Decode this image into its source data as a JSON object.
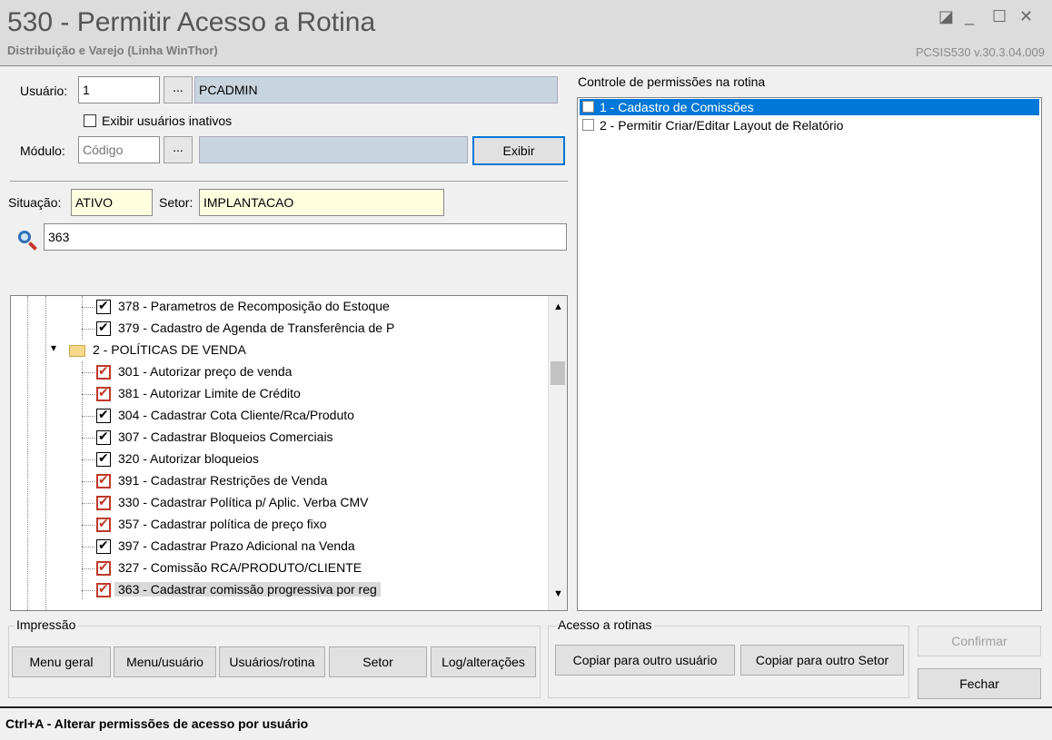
{
  "window": {
    "title": "530 - Permitir Acesso a Rotina",
    "subtitle": "Distribuição e Varejo (Linha WinThor)",
    "version": "PCSIS530  v.30.3.04.009",
    "buttons": [
      "◪",
      "_",
      "☐",
      "✕"
    ]
  },
  "form": {
    "usuario_label": "Usuário:",
    "usuario_code": "1",
    "usuario_name": "PCADMIN",
    "ellipsis": "...",
    "inativos_label": "Exibir usuários inativos",
    "modulo_label": "Módulo:",
    "modulo_placeholder": "Código",
    "exibir_label": "Exibir",
    "situacao_label": "Situação:",
    "situacao_value": "ATIVO",
    "setor_label": "Setor:",
    "setor_value": "IMPLANTACAO",
    "search_value": "363"
  },
  "tree": {
    "rows": [
      {
        "text": "378 - Parametros de Recomposição do Estoque",
        "check": "black"
      },
      {
        "text": "379 - Cadastro de Agenda de Transferência de P",
        "check": "black"
      },
      {
        "text": "2 - POLÍTICAS DE VENDA",
        "type": "folder"
      },
      {
        "text": "301 - Autorizar preço de venda",
        "check": "red"
      },
      {
        "text": "381 - Autorizar Limite de Crédito",
        "check": "red"
      },
      {
        "text": "304 - Cadastrar Cota Cliente/Rca/Produto",
        "check": "black"
      },
      {
        "text": "307 - Cadastrar Bloqueios Comerciais",
        "check": "black"
      },
      {
        "text": "320 - Autorizar bloqueios",
        "check": "black"
      },
      {
        "text": "391 - Cadastrar Restrições de Venda",
        "check": "red"
      },
      {
        "text": "330 - Cadastrar Política p/ Aplic. Verba CMV",
        "check": "red"
      },
      {
        "text": "357 - Cadastrar política de preço fixo",
        "check": "red"
      },
      {
        "text": "397 - Cadastrar Prazo Adicional na Venda",
        "check": "black"
      },
      {
        "text": "327 - Comissão RCA/PRODUTO/CLIENTE",
        "check": "red"
      },
      {
        "text": "363 - Cadastrar comissão progressiva por reg",
        "check": "red",
        "selected": true
      }
    ]
  },
  "permissions": {
    "title": "Controle de permissões na rotina",
    "items": [
      {
        "text": "1 - Cadastro de Comissões",
        "selected": true
      },
      {
        "text": "2 - Permitir Criar/Editar Layout de Relatório",
        "selected": false
      }
    ]
  },
  "impressao": {
    "label": "Impressão",
    "buttons": [
      "Menu geral",
      "Menu/usuário",
      "Usuários/rotina",
      "Setor",
      "Log/alterações"
    ]
  },
  "acesso": {
    "label": "Acesso a rotinas",
    "buttons": [
      "Copiar para outro usuário",
      "Copiar para outro Setor"
    ]
  },
  "actions": {
    "confirmar": "Confirmar",
    "fechar": "Fechar"
  },
  "status": {
    "text": "Ctrl+A - Alterar permissões de acesso por usuário"
  }
}
